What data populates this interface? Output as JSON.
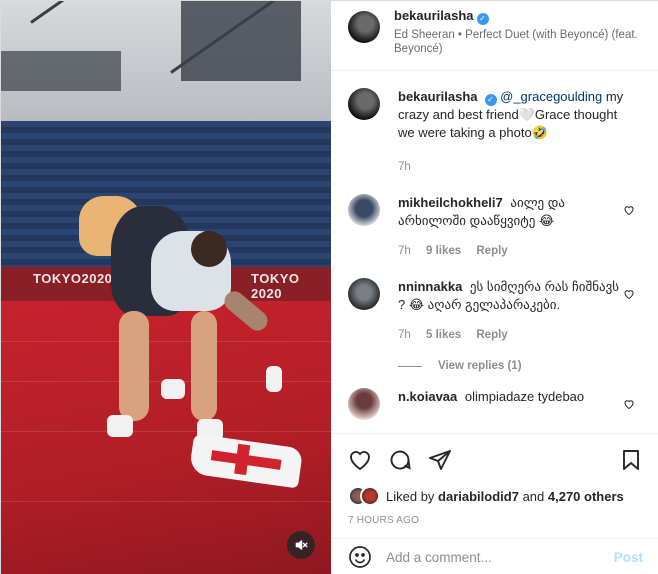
{
  "header": {
    "username": "bekaurilasha",
    "verified_icon": "verified-badge-icon",
    "audio": "Ed Sheeran • Perfect Duet (with Beyoncé) (feat. Beyoncé)"
  },
  "media": {
    "banner_left": "TOKYO2020",
    "banner_right": "TOKYO 2020",
    "mute_icon": "muted-speaker-icon"
  },
  "caption": {
    "username": "bekaurilasha",
    "mention": "@_gracegoulding",
    "text": " my crazy and best friend🤍Grace thought we were taking a photo🤣",
    "time": "7h"
  },
  "comments": [
    {
      "username": "mikheilchokheli7",
      "text": "აილე და არხილოში დააწყვიტე 😂",
      "time": "7h",
      "likes": "9 likes",
      "reply": "Reply"
    },
    {
      "username": "nninnakka",
      "text": "ეს სიმღერა რას ჩიშნავს ? 😂 აღარ გელაპარაკები.",
      "time": "7h",
      "likes": "5 likes",
      "reply": "Reply",
      "view_replies": "View replies (1)"
    },
    {
      "username": "n.koiavaa",
      "text": "olimpiadaze tydebao"
    }
  ],
  "actions": {
    "liked_by_prefix": "Liked by ",
    "liked_by_user": "dariabilodid7",
    "liked_by_and": " and ",
    "liked_by_count": "4,270 others",
    "time_ago": "7 HOURS AGO"
  },
  "add_comment": {
    "placeholder": "Add a comment...",
    "post_label": "Post"
  },
  "colors": {
    "accent": "#0095f6",
    "post_disabled": "#b2dffc",
    "verified": "#3897f0"
  }
}
